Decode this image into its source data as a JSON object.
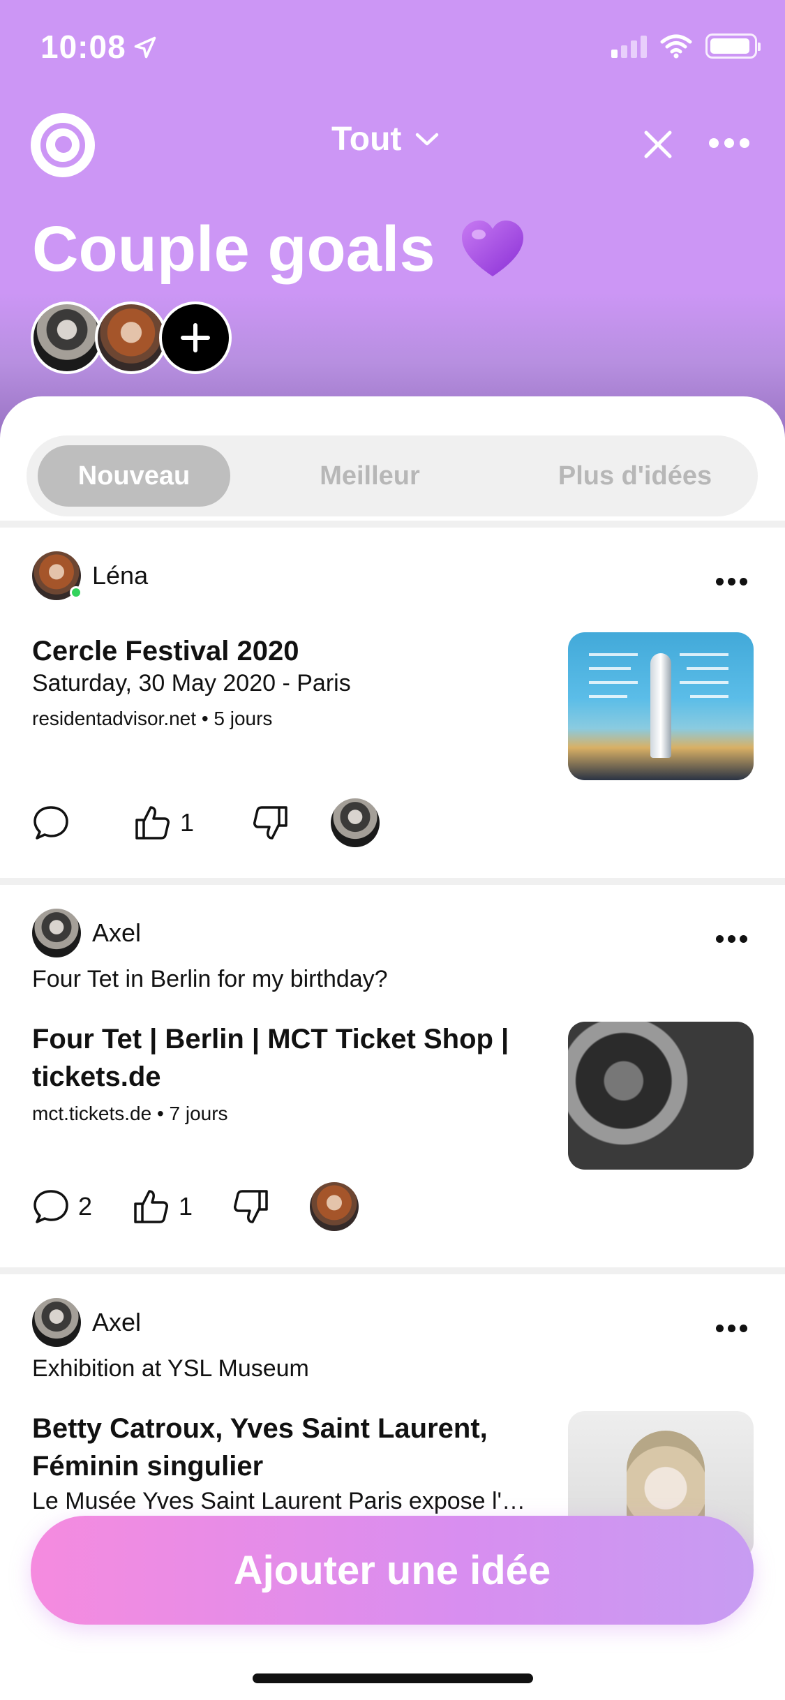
{
  "status_bar": {
    "time": "10:08"
  },
  "nav": {
    "filter_label": "Tout"
  },
  "board": {
    "title": "Couple goals"
  },
  "tabs": [
    {
      "label": "Nouveau",
      "active": true
    },
    {
      "label": "Meilleur",
      "active": false
    },
    {
      "label": "Plus d'idées",
      "active": false
    }
  ],
  "posts": [
    {
      "author": "Léna",
      "comment": "",
      "title": "Cercle Festival 2020",
      "description": "Saturday, 30 May 2020 - Paris",
      "meta": "residentadvisor.net • 5 jours",
      "comment_count": "",
      "like_count": "1"
    },
    {
      "author": "Axel",
      "comment": "Four Tet in Berlin for my birthday?",
      "title": "Four Tet | Berlin | MCT Ticket Shop | tickets.de",
      "description": "",
      "meta": "mct.tickets.de • 7 jours",
      "comment_count": "2",
      "like_count": "1"
    },
    {
      "author": "Axel",
      "comment": "Exhibition at YSL Museum",
      "title": "Betty Catroux, Yves Saint Laurent, Féminin singulier",
      "description": "Le Musée Yves Saint Laurent Paris expose l'…",
      "meta": "",
      "comment_count": "",
      "like_count": ""
    }
  ],
  "cta": {
    "label": "Ajouter une idée"
  },
  "colors": {
    "header": "#cc96f5",
    "cta_start": "#f58bdf",
    "cta_end": "#c79cf2",
    "online": "#33d35c"
  }
}
